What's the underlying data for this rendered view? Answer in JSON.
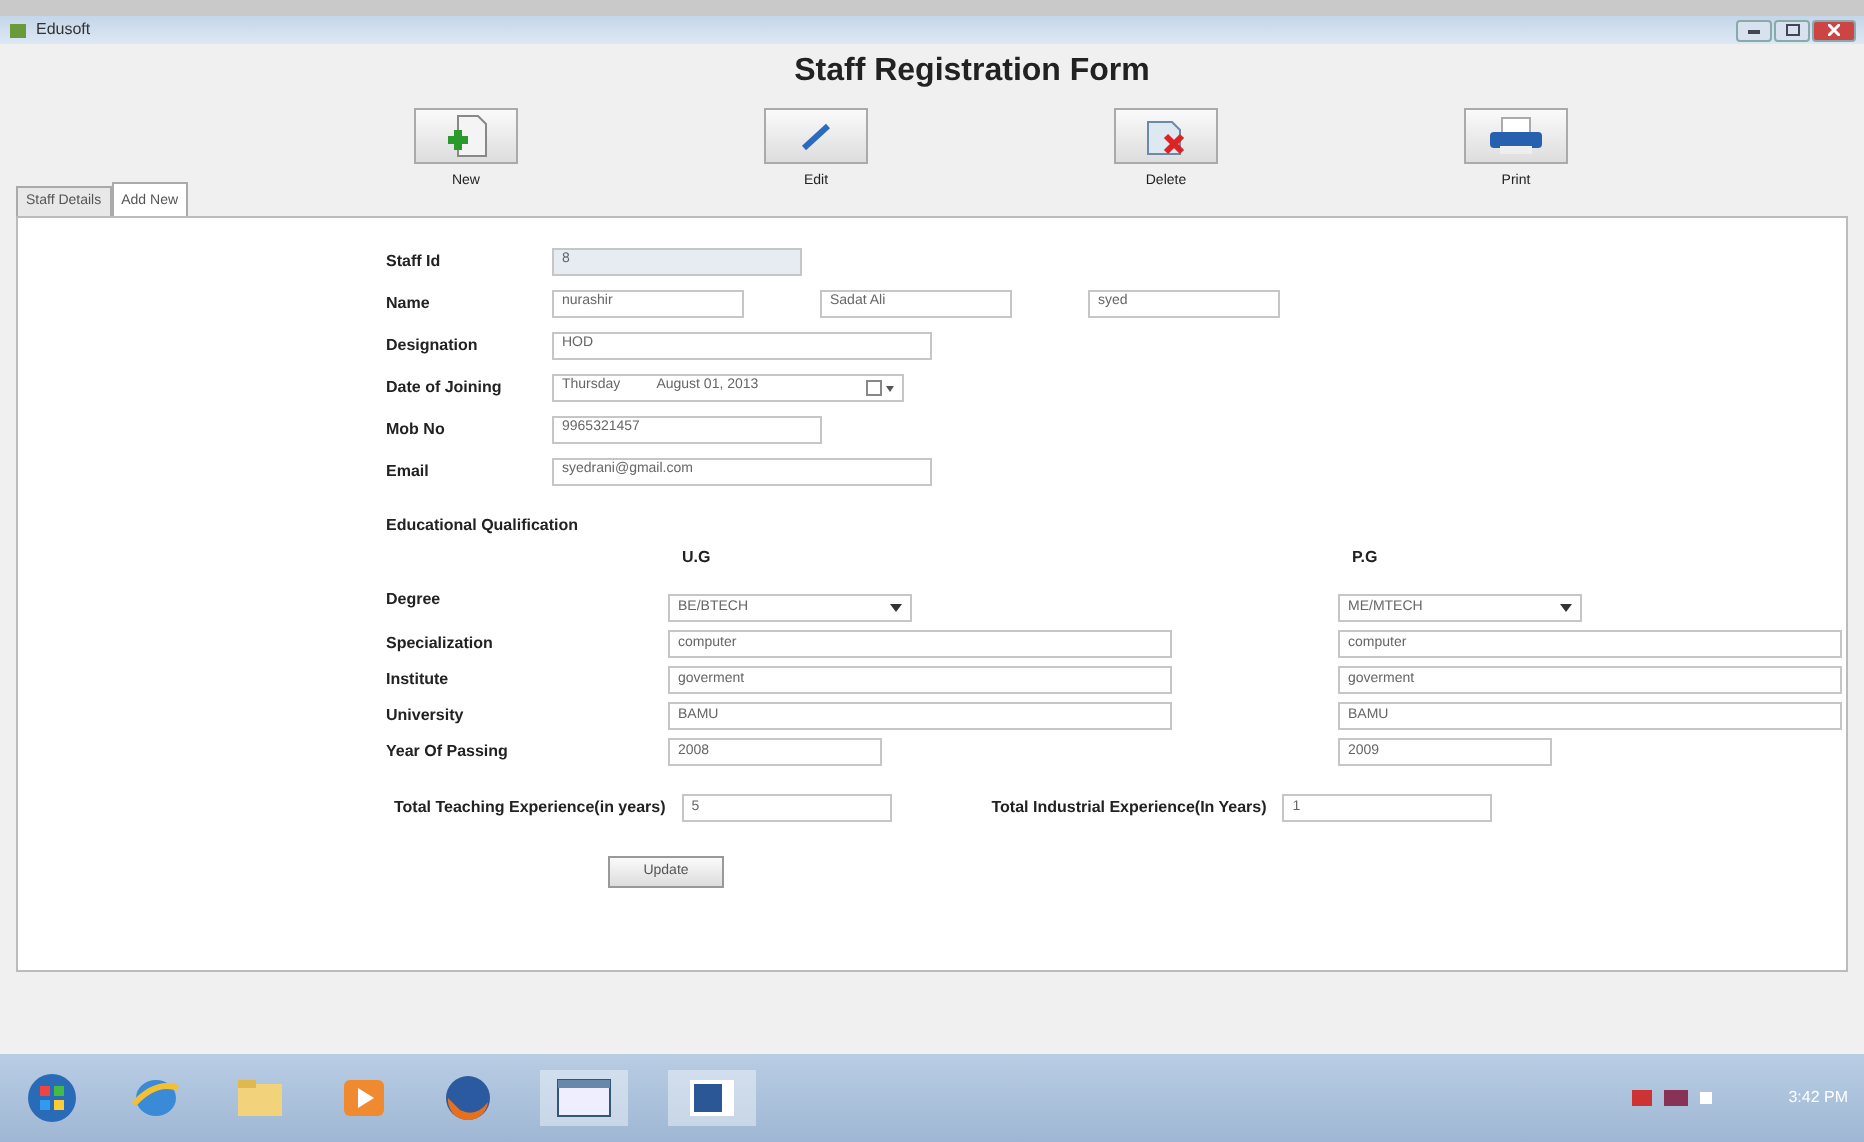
{
  "window": {
    "title": "Edusoft"
  },
  "form_title": "Staff Registration Form",
  "toolbar": [
    {
      "label": "New",
      "kind": "new"
    },
    {
      "label": "Edit",
      "kind": "edit"
    },
    {
      "label": "Delete",
      "kind": "delete"
    },
    {
      "label": "Print",
      "kind": "print"
    }
  ],
  "tabs": [
    {
      "label": "Staff Details",
      "selected": false
    },
    {
      "label": "Add New",
      "selected": true
    }
  ],
  "fields": [
    {
      "label": "Staff Id",
      "kind": "id",
      "values": [
        "8"
      ]
    },
    {
      "label": "Name",
      "kind": "names",
      "values": [
        "nurashir",
        "Sadat Ali",
        "syed"
      ]
    },
    {
      "label": "Designation",
      "kind": "text",
      "values": [
        "HOD"
      ]
    },
    {
      "label": "Date of Joining",
      "kind": "date",
      "values": [
        "Thursday",
        "August   01, 2013"
      ]
    },
    {
      "label": "Mob No",
      "kind": "short",
      "values": [
        "9965321457"
      ]
    },
    {
      "label": "Email",
      "kind": "text",
      "values": [
        "syedrani@gmail.com"
      ]
    }
  ],
  "education": {
    "title": "Educational Qualification",
    "columns": [
      "U.G",
      "P.G"
    ],
    "rows": [
      {
        "label": "Degree",
        "kind": "combo",
        "values": [
          "BE/BTECH",
          "ME/MTECH"
        ]
      },
      {
        "label": "Specialization",
        "kind": "text",
        "values": [
          "computer",
          "computer"
        ]
      },
      {
        "label": "Institute",
        "kind": "text",
        "values": [
          "goverment",
          "goverment"
        ]
      },
      {
        "label": "University",
        "kind": "text",
        "values": [
          "BAMU",
          "BAMU"
        ]
      },
      {
        "label": "Year Of Passing",
        "kind": "short",
        "values": [
          "2008",
          "2009"
        ]
      }
    ]
  },
  "experience": [
    {
      "label": "Total Teaching Experience(in years)",
      "value": "5"
    },
    {
      "label": "Total Industrial Experience(In Years)",
      "value": "1"
    }
  ],
  "update_button": "Update",
  "taskbar": {
    "clock": "3:42 PM"
  }
}
